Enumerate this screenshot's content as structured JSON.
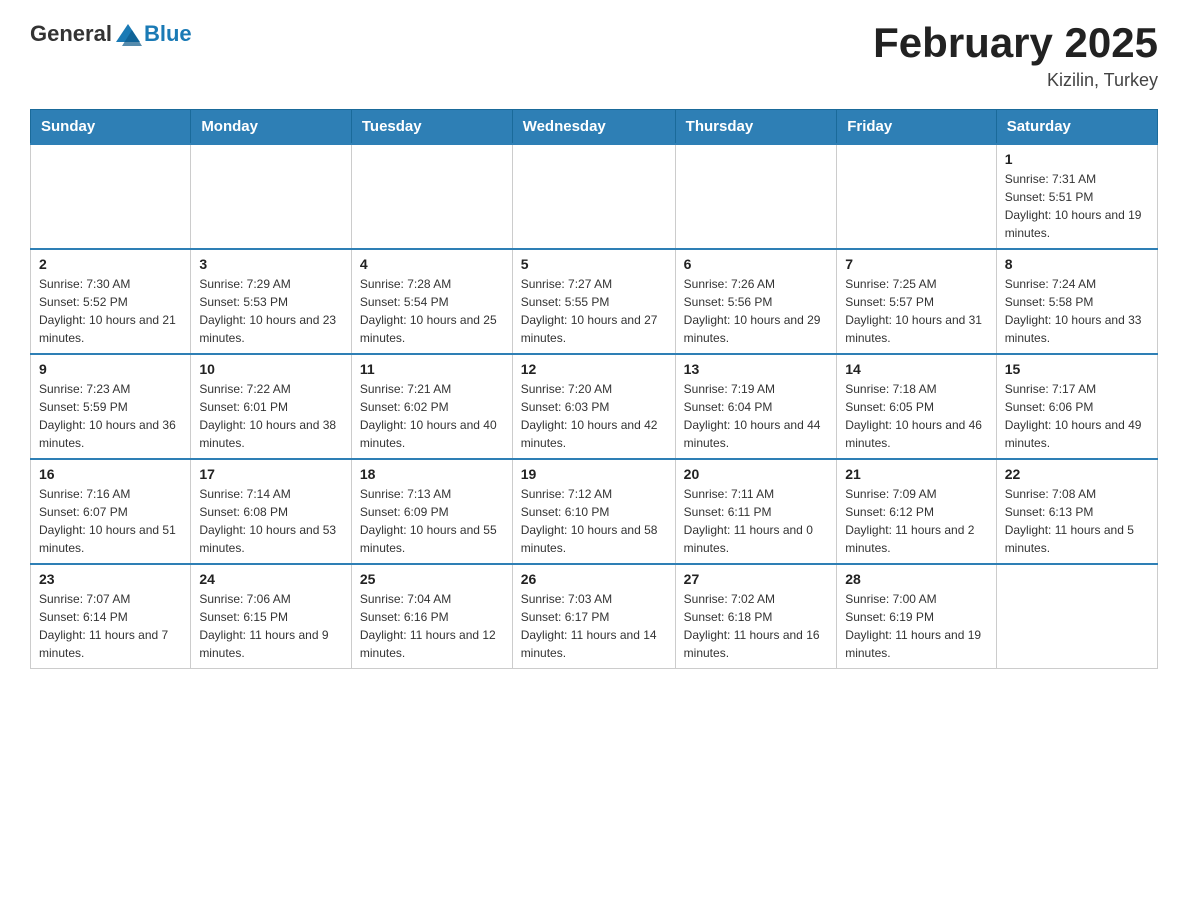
{
  "logo": {
    "general": "General",
    "blue": "Blue"
  },
  "title": "February 2025",
  "location": "Kizilin, Turkey",
  "days_of_week": [
    "Sunday",
    "Monday",
    "Tuesday",
    "Wednesday",
    "Thursday",
    "Friday",
    "Saturday"
  ],
  "weeks": [
    [
      {
        "day": "",
        "info": ""
      },
      {
        "day": "",
        "info": ""
      },
      {
        "day": "",
        "info": ""
      },
      {
        "day": "",
        "info": ""
      },
      {
        "day": "",
        "info": ""
      },
      {
        "day": "",
        "info": ""
      },
      {
        "day": "1",
        "info": "Sunrise: 7:31 AM\nSunset: 5:51 PM\nDaylight: 10 hours and 19 minutes."
      }
    ],
    [
      {
        "day": "2",
        "info": "Sunrise: 7:30 AM\nSunset: 5:52 PM\nDaylight: 10 hours and 21 minutes."
      },
      {
        "day": "3",
        "info": "Sunrise: 7:29 AM\nSunset: 5:53 PM\nDaylight: 10 hours and 23 minutes."
      },
      {
        "day": "4",
        "info": "Sunrise: 7:28 AM\nSunset: 5:54 PM\nDaylight: 10 hours and 25 minutes."
      },
      {
        "day": "5",
        "info": "Sunrise: 7:27 AM\nSunset: 5:55 PM\nDaylight: 10 hours and 27 minutes."
      },
      {
        "day": "6",
        "info": "Sunrise: 7:26 AM\nSunset: 5:56 PM\nDaylight: 10 hours and 29 minutes."
      },
      {
        "day": "7",
        "info": "Sunrise: 7:25 AM\nSunset: 5:57 PM\nDaylight: 10 hours and 31 minutes."
      },
      {
        "day": "8",
        "info": "Sunrise: 7:24 AM\nSunset: 5:58 PM\nDaylight: 10 hours and 33 minutes."
      }
    ],
    [
      {
        "day": "9",
        "info": "Sunrise: 7:23 AM\nSunset: 5:59 PM\nDaylight: 10 hours and 36 minutes."
      },
      {
        "day": "10",
        "info": "Sunrise: 7:22 AM\nSunset: 6:01 PM\nDaylight: 10 hours and 38 minutes."
      },
      {
        "day": "11",
        "info": "Sunrise: 7:21 AM\nSunset: 6:02 PM\nDaylight: 10 hours and 40 minutes."
      },
      {
        "day": "12",
        "info": "Sunrise: 7:20 AM\nSunset: 6:03 PM\nDaylight: 10 hours and 42 minutes."
      },
      {
        "day": "13",
        "info": "Sunrise: 7:19 AM\nSunset: 6:04 PM\nDaylight: 10 hours and 44 minutes."
      },
      {
        "day": "14",
        "info": "Sunrise: 7:18 AM\nSunset: 6:05 PM\nDaylight: 10 hours and 46 minutes."
      },
      {
        "day": "15",
        "info": "Sunrise: 7:17 AM\nSunset: 6:06 PM\nDaylight: 10 hours and 49 minutes."
      }
    ],
    [
      {
        "day": "16",
        "info": "Sunrise: 7:16 AM\nSunset: 6:07 PM\nDaylight: 10 hours and 51 minutes."
      },
      {
        "day": "17",
        "info": "Sunrise: 7:14 AM\nSunset: 6:08 PM\nDaylight: 10 hours and 53 minutes."
      },
      {
        "day": "18",
        "info": "Sunrise: 7:13 AM\nSunset: 6:09 PM\nDaylight: 10 hours and 55 minutes."
      },
      {
        "day": "19",
        "info": "Sunrise: 7:12 AM\nSunset: 6:10 PM\nDaylight: 10 hours and 58 minutes."
      },
      {
        "day": "20",
        "info": "Sunrise: 7:11 AM\nSunset: 6:11 PM\nDaylight: 11 hours and 0 minutes."
      },
      {
        "day": "21",
        "info": "Sunrise: 7:09 AM\nSunset: 6:12 PM\nDaylight: 11 hours and 2 minutes."
      },
      {
        "day": "22",
        "info": "Sunrise: 7:08 AM\nSunset: 6:13 PM\nDaylight: 11 hours and 5 minutes."
      }
    ],
    [
      {
        "day": "23",
        "info": "Sunrise: 7:07 AM\nSunset: 6:14 PM\nDaylight: 11 hours and 7 minutes."
      },
      {
        "day": "24",
        "info": "Sunrise: 7:06 AM\nSunset: 6:15 PM\nDaylight: 11 hours and 9 minutes."
      },
      {
        "day": "25",
        "info": "Sunrise: 7:04 AM\nSunset: 6:16 PM\nDaylight: 11 hours and 12 minutes."
      },
      {
        "day": "26",
        "info": "Sunrise: 7:03 AM\nSunset: 6:17 PM\nDaylight: 11 hours and 14 minutes."
      },
      {
        "day": "27",
        "info": "Sunrise: 7:02 AM\nSunset: 6:18 PM\nDaylight: 11 hours and 16 minutes."
      },
      {
        "day": "28",
        "info": "Sunrise: 7:00 AM\nSunset: 6:19 PM\nDaylight: 11 hours and 19 minutes."
      },
      {
        "day": "",
        "info": ""
      }
    ]
  ]
}
